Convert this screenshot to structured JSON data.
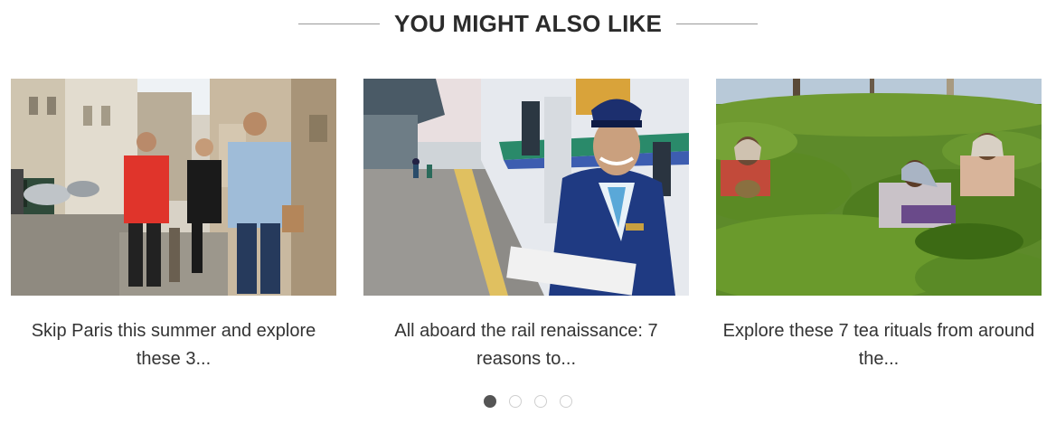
{
  "section": {
    "title": "YOU MIGHT ALSO LIKE"
  },
  "cards": [
    {
      "title": "Skip Paris this summer and explore these 3...",
      "image_icon": "paris-street-photo"
    },
    {
      "title": "All aboard the rail renaissance: 7 reasons to...",
      "image_icon": "train-platform-photo"
    },
    {
      "title": "Explore these 7 tea rituals from around the...",
      "image_icon": "tea-plantation-photo"
    }
  ],
  "carousel": {
    "page_count": 4,
    "active_page": 1
  },
  "colors": {
    "title_text": "#2b2b2b",
    "body_text": "#333333",
    "dot_active": "#555555",
    "dot_inactive": "#cfcfcf"
  }
}
